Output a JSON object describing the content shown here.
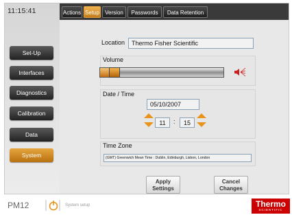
{
  "clock": "11:15:41",
  "nav": {
    "setup": "Set-Up",
    "interfaces": "Interfaces",
    "diagnostics": "Diagnostics",
    "calibration": "Calibration",
    "data": "Data",
    "system": "System"
  },
  "tabs": {
    "actions": "Actions",
    "setup": "Setup",
    "version": "Version",
    "passwords": "Passwords",
    "data_retention": "Data Retention"
  },
  "location": {
    "label": "Location",
    "value": "Thermo Fisher Scientific"
  },
  "volume": {
    "label": "Volume",
    "level": 0.16,
    "icon": "speaker-icon"
  },
  "datetime": {
    "label": "Date / Time",
    "date": "05/10/2007",
    "hour": "11",
    "separator": ":",
    "minute": "15"
  },
  "timezone": {
    "label": "Time Zone",
    "value": "(GMT) Greenwich Mean Time : Dublin, Edinburgh, Lisbon, London"
  },
  "buttons": {
    "apply_line1": "Apply",
    "apply_line2": "Settings",
    "cancel_line1": "Cancel",
    "cancel_line2": "Changes"
  },
  "footer": {
    "model": "PM12",
    "status": "System setup",
    "brand": "Thermo",
    "brand_sub": "SCIENTIFIC"
  },
  "colors": {
    "accent": "#e8931c",
    "brand": "#cc0000",
    "tabbar": "#3a3a3a"
  }
}
